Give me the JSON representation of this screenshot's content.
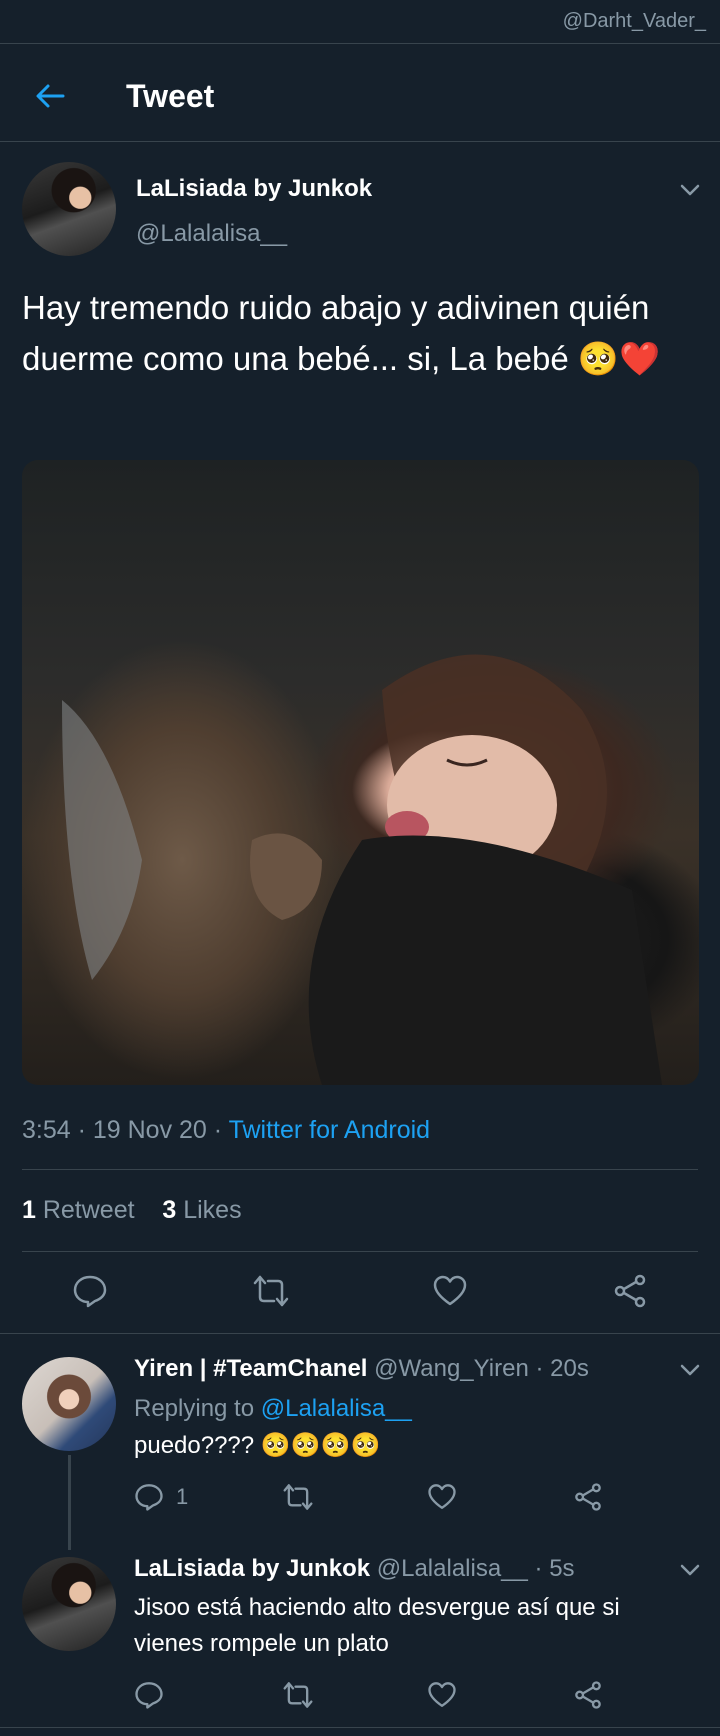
{
  "watermark": "@Darht_Vader_",
  "header": {
    "title": "Tweet"
  },
  "tweet": {
    "author_name": "LaLisiada by Junkok",
    "author_handle": "@Lalalalisa__",
    "text": "Hay tremendo ruido abajo y adivinen quién duerme como una bebé... si, La bebé 🥺❤️",
    "time": "3:54 · 19 Nov 20 · ",
    "source": "Twitter for Android",
    "retweets_count": "1",
    "retweets_label": " Retweet",
    "likes_count": "3",
    "likes_label": " Likes"
  },
  "replies": [
    {
      "name": "Yiren | #TeamChanel",
      "meta": " @Wang_Yiren · 20s",
      "replying_prefix": "Replying to ",
      "replying_handle": "@Lalalalisa__",
      "text": "puedo???? 🥺🥺🥺🥺",
      "reply_count": "1"
    },
    {
      "name": "LaLisiada by Junkok",
      "meta": " @Lalalalisa__ · 5s",
      "text": "Jisoo está haciendo alto desvergue así que si vienes rompele un plato",
      "reply_count": ""
    }
  ],
  "icons": {
    "back": "arrow-left-icon",
    "chevron": "chevron-down-icon",
    "reply": "comment-icon",
    "retweet": "retweet-icon",
    "like": "heart-icon",
    "share": "share-icon"
  },
  "colors": {
    "background": "#15202b",
    "accent": "#1da1f2",
    "secondary_text": "#8899a6",
    "divider": "#38444d"
  }
}
